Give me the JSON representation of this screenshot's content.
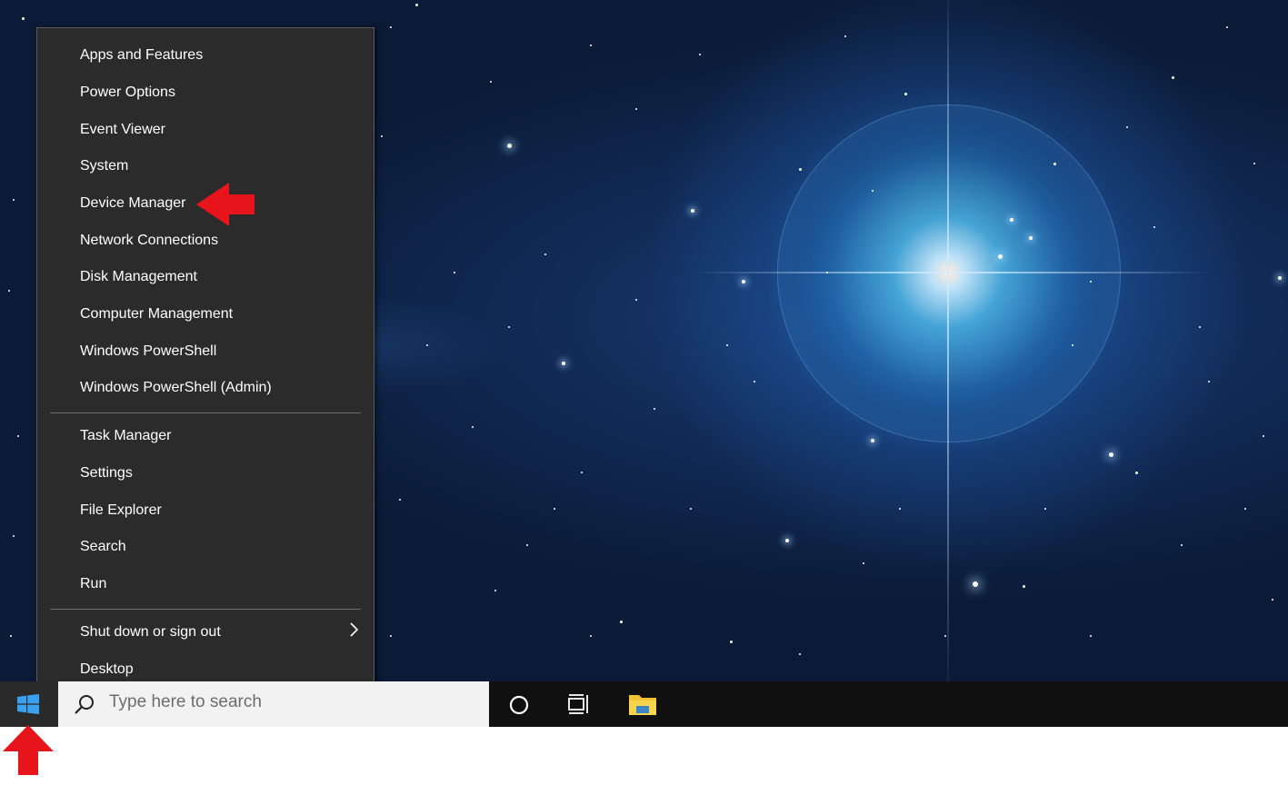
{
  "context_menu": {
    "items": [
      {
        "label": "Apps and Features"
      },
      {
        "label": "Power Options"
      },
      {
        "label": "Event Viewer"
      },
      {
        "label": "System"
      },
      {
        "label": "Device Manager"
      },
      {
        "label": "Network Connections"
      },
      {
        "label": "Disk Management"
      },
      {
        "label": "Computer Management"
      },
      {
        "label": "Windows PowerShell"
      },
      {
        "label": "Windows PowerShell (Admin)"
      },
      {
        "label": "Task Manager"
      },
      {
        "label": "Settings"
      },
      {
        "label": "File Explorer"
      },
      {
        "label": "Search"
      },
      {
        "label": "Run"
      },
      {
        "label": "Shut down or sign out"
      },
      {
        "label": "Desktop"
      }
    ]
  },
  "taskbar": {
    "search_placeholder": "Type here to search",
    "icons": [
      "windows-start-icon",
      "search-icon",
      "cortana-circle-icon",
      "task-view-icon",
      "file-explorer-icon"
    ]
  },
  "annotations": {
    "arrow_color": "#e8141b",
    "arrows": [
      "red-arrow-pointing-device-manager",
      "red-arrow-pointing-start-button"
    ]
  },
  "colors": {
    "menu_background": "#2b2b2b",
    "taskbar_background": "#101010",
    "windows_logo": "#3aa0f0",
    "folder_yellow": "#f2c230"
  }
}
